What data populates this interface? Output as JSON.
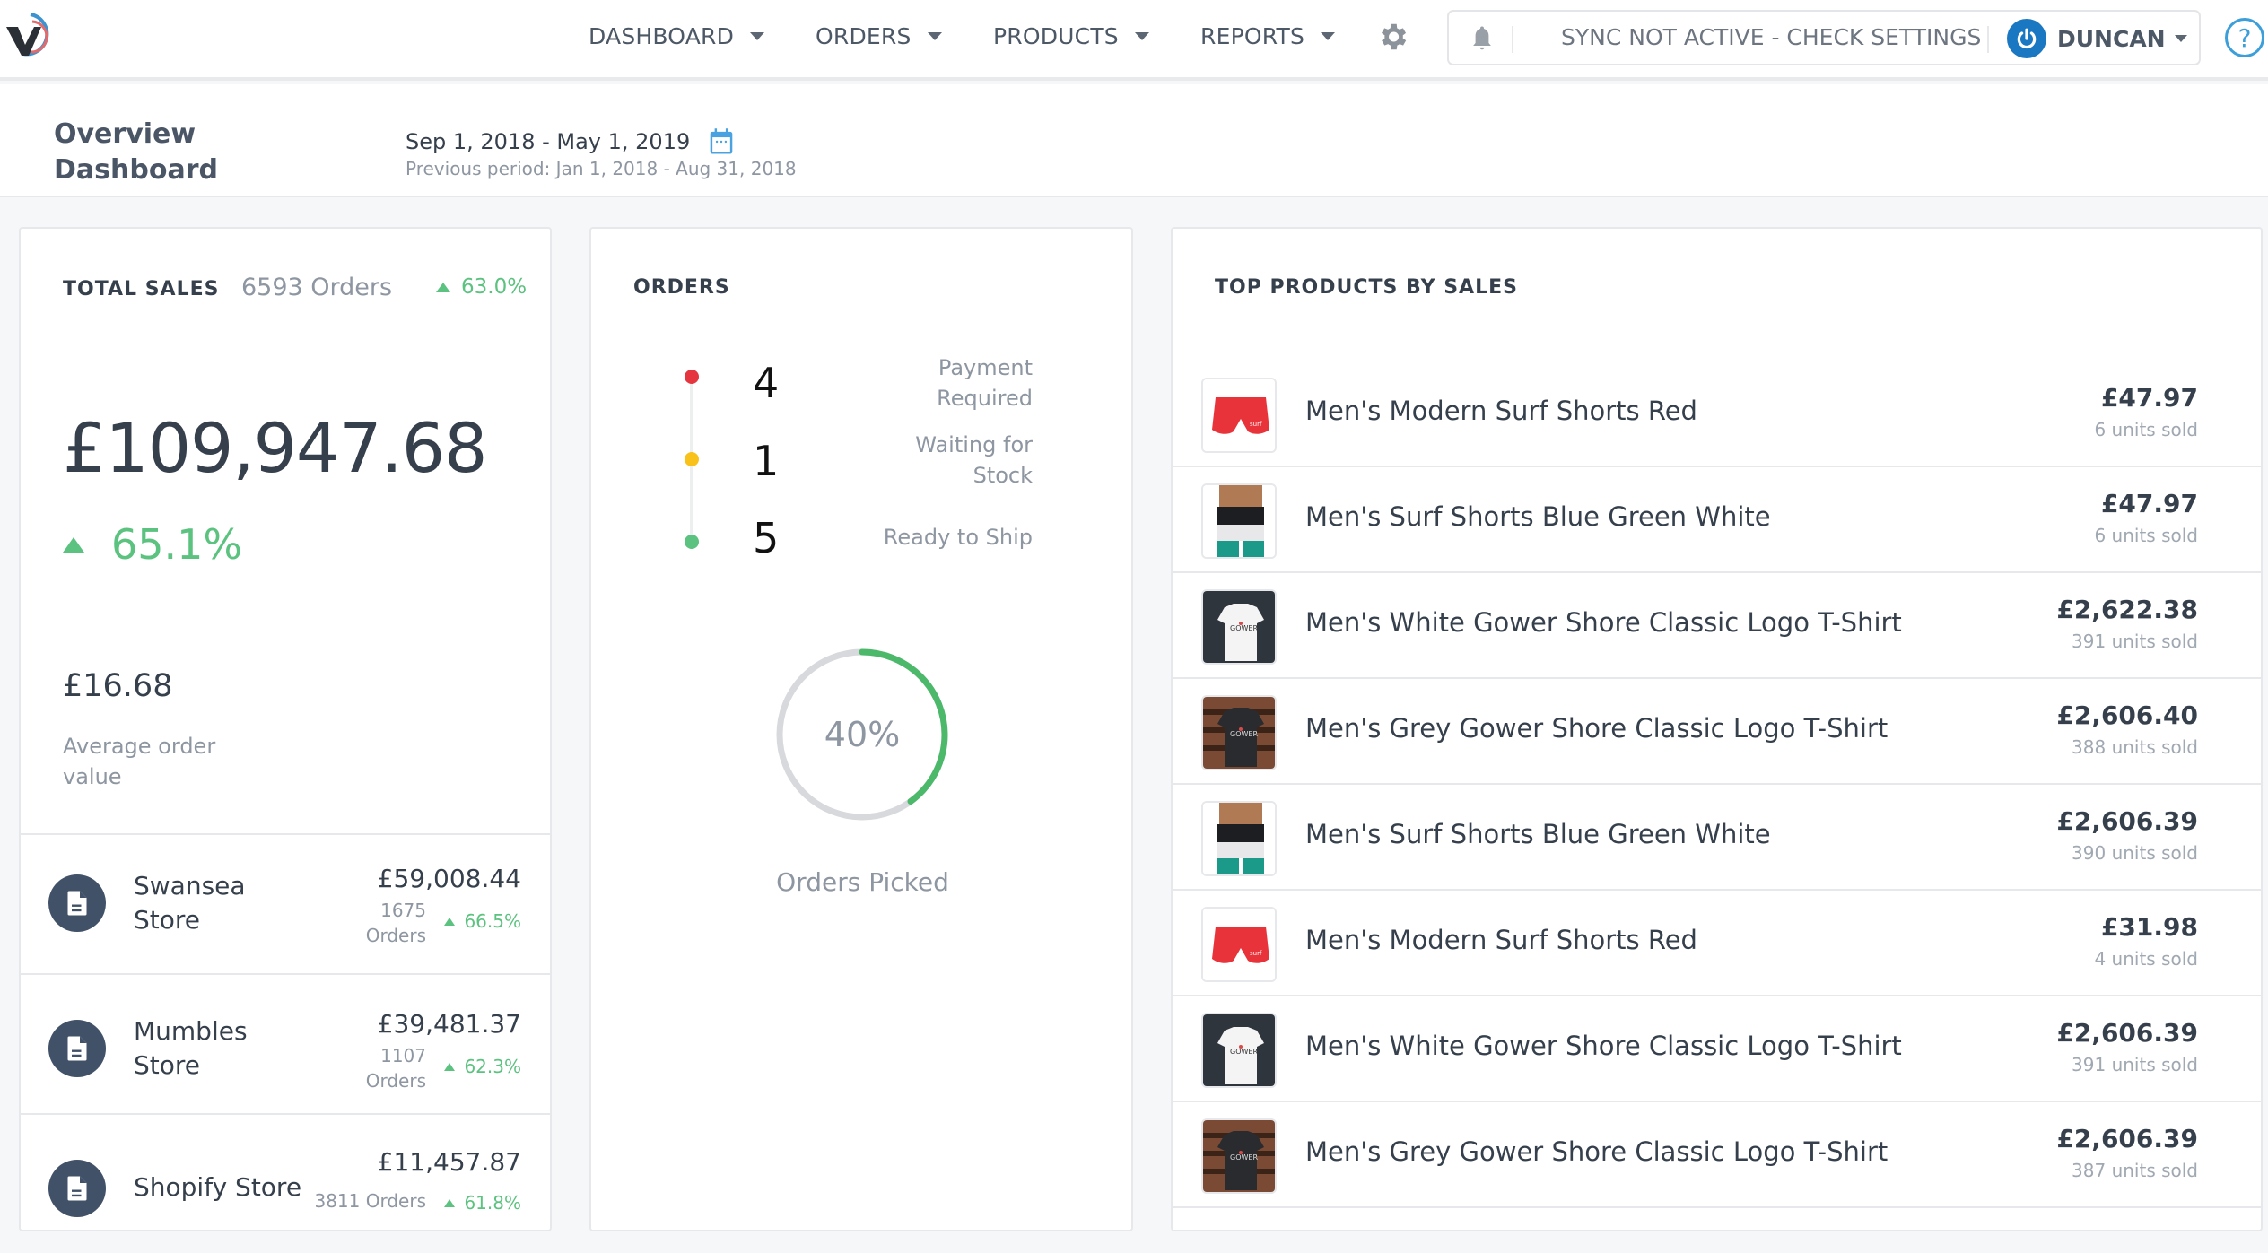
{
  "navbar": {
    "logo": "v-logo",
    "items": [
      {
        "label": "DASHBOARD"
      },
      {
        "label": "ORDERS"
      },
      {
        "label": "PRODUCTS"
      },
      {
        "label": "REPORTS"
      }
    ],
    "sync_status": "SYNC NOT ACTIVE - CHECK SETTINGS",
    "user_name": "DUNCAN",
    "help_label": "?"
  },
  "header": {
    "title_line1": "Overview",
    "title_line2": "Dashboard",
    "date_range": "Sep 1, 2018 - May 1, 2019",
    "previous_period": "Previous period: Jan 1, 2018 - Aug 31, 2018"
  },
  "total_sales": {
    "title": "TOTAL SALES",
    "orders": "6593 Orders",
    "orders_change": "63.0%",
    "amount": "£109,947.68",
    "amount_change": "65.1%",
    "avg_order_value": "£16.68",
    "avg_order_label": "Average order value",
    "stores": [
      {
        "name": "Swansea Store",
        "amount": "£59,008.44",
        "orders": "1675 Orders",
        "change": "66.5%"
      },
      {
        "name": "Mumbles Store",
        "amount": "£39,481.37",
        "orders": "1107 Orders",
        "change": "62.3%"
      },
      {
        "name": "Shopify Store",
        "amount": "£11,457.87",
        "orders": "3811 Orders",
        "change": "61.8%"
      }
    ]
  },
  "orders": {
    "title": "ORDERS",
    "statuses": [
      {
        "count": "4",
        "label": "Payment Required",
        "color": "#e5363f"
      },
      {
        "count": "1",
        "label": "Waiting for Stock",
        "color": "#f9c21b"
      },
      {
        "count": "5",
        "label": "Ready to Ship",
        "color": "#5cc27f"
      }
    ],
    "picked_percent": 40,
    "picked_percent_label": "40%",
    "picked_label": "Orders Picked"
  },
  "top_products": {
    "title": "TOP PRODUCTS BY SALES",
    "items": [
      {
        "name": "Men's Modern Surf Shorts Red",
        "amount": "£47.97",
        "units": "6 units sold",
        "thumb": "red-shorts"
      },
      {
        "name": "Men's Surf Shorts Blue Green White",
        "amount": "£47.97",
        "units": "6 units sold",
        "thumb": "tricolor-shorts"
      },
      {
        "name": "Men's White Gower Shore Classic Logo T-Shirt",
        "amount": "£2,622.38",
        "units": "391 units sold",
        "thumb": "white-tshirt"
      },
      {
        "name": "Men's Grey Gower Shore Classic Logo T-Shirt",
        "amount": "£2,606.40",
        "units": "388 units sold",
        "thumb": "grey-tshirt"
      },
      {
        "name": "Men's Surf Shorts Blue Green White",
        "amount": "£2,606.39",
        "units": "390 units sold",
        "thumb": "tricolor-shorts"
      },
      {
        "name": "Men's Modern Surf Shorts Red",
        "amount": "£31.98",
        "units": "4 units sold",
        "thumb": "red-shorts"
      },
      {
        "name": "Men's White Gower Shore Classic Logo T-Shirt",
        "amount": "£2,606.39",
        "units": "391 units sold",
        "thumb": "white-tshirt"
      },
      {
        "name": "Men's Grey Gower Shore Classic Logo T-Shirt",
        "amount": "£2,606.39",
        "units": "387 units sold",
        "thumb": "grey-tshirt"
      }
    ]
  },
  "colors": {
    "accent_green": "#5cc27f",
    "accent_blue": "#1a78c2",
    "text_dark": "#36404c",
    "text_muted": "#8d96a1"
  }
}
